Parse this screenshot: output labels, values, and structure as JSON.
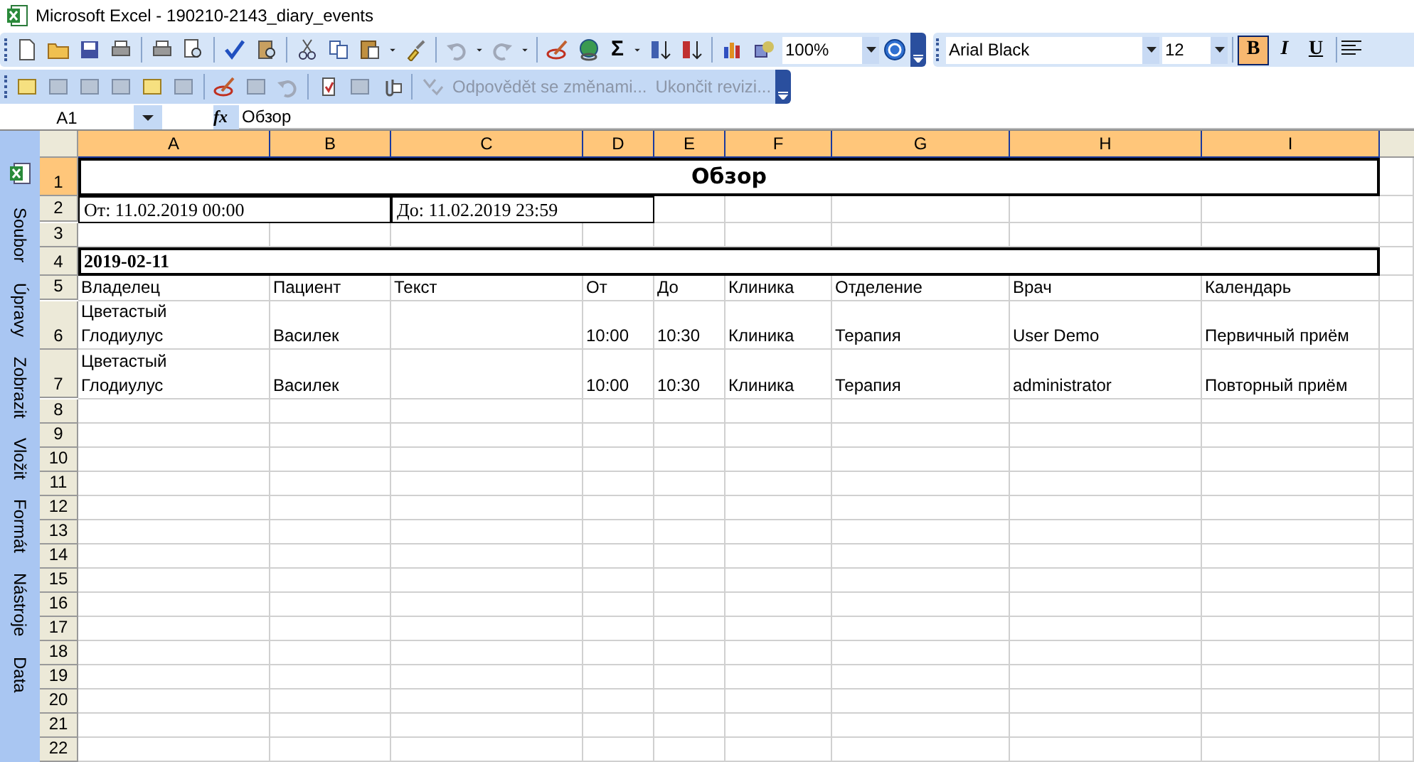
{
  "window": {
    "title": "Microsoft Excel - 190210-2143_diary_events"
  },
  "toolbar": {
    "sum_symbol": "Σ",
    "zoom": "100%",
    "font": "Arial Black",
    "font_size": "12",
    "format_buttons": [
      {
        "label": "B",
        "kind": "bold",
        "selected": true
      },
      {
        "label": "I",
        "kind": "italic",
        "selected": false
      },
      {
        "label": "U",
        "kind": "underline",
        "selected": false
      }
    ]
  },
  "review_toolbar": {
    "items": [
      {
        "label": "Odpovědět se změnami...",
        "disabled": true
      },
      {
        "label": "Ukončit revizi...",
        "disabled": true
      }
    ]
  },
  "formula_bar": {
    "name_box": "A1",
    "fx": "fx",
    "value": "Обзор"
  },
  "menu": [
    "Soubor",
    "Úpravy",
    "Zobrazit",
    "Vložit",
    "Formát",
    "Nástroje",
    "Data"
  ],
  "sheet": {
    "columns": [
      {
        "label": "A",
        "selected": true
      },
      {
        "label": "B",
        "selected": true
      },
      {
        "label": "C",
        "selected": true
      },
      {
        "label": "D",
        "selected": true
      },
      {
        "label": "E",
        "selected": true
      },
      {
        "label": "F",
        "selected": true
      },
      {
        "label": "G",
        "selected": true
      },
      {
        "label": "H",
        "selected": true
      },
      {
        "label": "I",
        "selected": true
      }
    ],
    "rows": [
      {
        "number": "1",
        "selected": true,
        "kind": "title",
        "cells": [
          "Обзор"
        ]
      },
      {
        "number": "2",
        "selected": false,
        "kind": "range",
        "cells": [
          "От: 11.02.2019 00:00",
          "До: 11.02.2019 23:59"
        ]
      },
      {
        "number": "3",
        "selected": false,
        "kind": "empty"
      },
      {
        "number": "4",
        "selected": false,
        "kind": "group",
        "cells": [
          "2019-02-11"
        ]
      },
      {
        "number": "5",
        "selected": false,
        "kind": "data",
        "cells": [
          "Владелец",
          "Пациент",
          "Текст",
          "От",
          "До",
          "Клиника",
          "Отделение",
          "Врач",
          "Календарь"
        ]
      },
      {
        "number": "6",
        "selected": false,
        "kind": "data",
        "cells": [
          "Цветастый\nГлодиулус",
          "Василек",
          null,
          "10:00",
          "10:30",
          "Клиника",
          "Терапия",
          "User Demo",
          "Первичный приём"
        ]
      },
      {
        "number": "7",
        "selected": false,
        "kind": "data",
        "cells": [
          "Цветастый\nГлодиулус",
          "Василек",
          null,
          "10:00",
          "10:30",
          "Клиника",
          "Терапия",
          "administrator",
          "Повторный приём"
        ]
      },
      {
        "number": "8",
        "selected": false,
        "kind": "empty"
      },
      {
        "number": "9",
        "selected": false,
        "kind": "empty"
      },
      {
        "number": "10",
        "selected": false,
        "kind": "empty"
      },
      {
        "number": "11",
        "selected": false,
        "kind": "empty"
      },
      {
        "number": "12",
        "selected": false,
        "kind": "empty"
      },
      {
        "number": "13",
        "selected": false,
        "kind": "empty"
      },
      {
        "number": "14",
        "selected": false,
        "kind": "empty"
      },
      {
        "number": "15",
        "selected": false,
        "kind": "empty"
      },
      {
        "number": "16",
        "selected": false,
        "kind": "empty"
      },
      {
        "number": "17",
        "selected": false,
        "kind": "empty"
      },
      {
        "number": "18",
        "selected": false,
        "kind": "empty"
      },
      {
        "number": "19",
        "selected": false,
        "kind": "empty"
      },
      {
        "number": "20",
        "selected": false,
        "kind": "empty"
      },
      {
        "number": "21",
        "selected": false,
        "kind": "empty"
      },
      {
        "number": "22",
        "selected": false,
        "kind": "empty"
      }
    ]
  }
}
